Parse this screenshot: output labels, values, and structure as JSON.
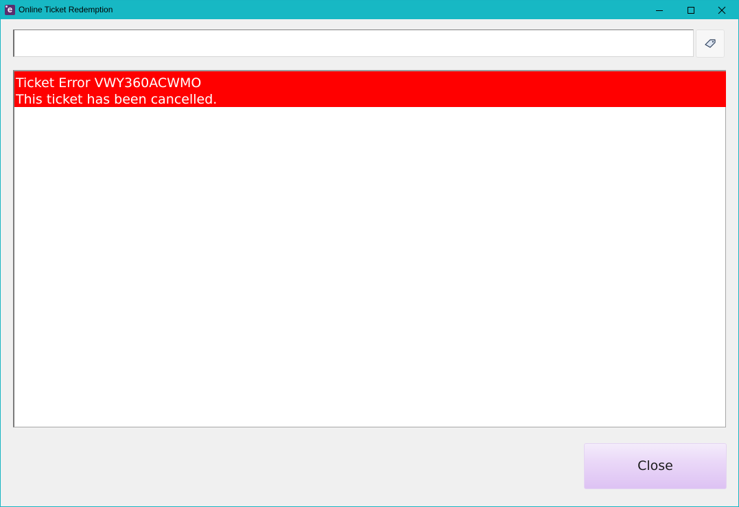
{
  "window": {
    "title": "Online Ticket Redemption",
    "icon": "app-logo-e-icon",
    "app_icon_letter": "e",
    "controls": {
      "minimize": "minimize-icon",
      "maximize": "maximize-icon",
      "close": "close-icon"
    }
  },
  "search": {
    "value": "",
    "placeholder": "",
    "button_icon": "ticket-tag-icon"
  },
  "message": {
    "line1": "Ticket Error VWY360ACWMO",
    "line2": "This ticket has been cancelled.",
    "banner_color": "#ff0000",
    "text_color": "#ffffff"
  },
  "footer": {
    "close_label": "Close"
  },
  "colors": {
    "titlebar": "#17b8c4",
    "window_bg": "#f0f0f0",
    "close_button": "#ddc2f3"
  }
}
